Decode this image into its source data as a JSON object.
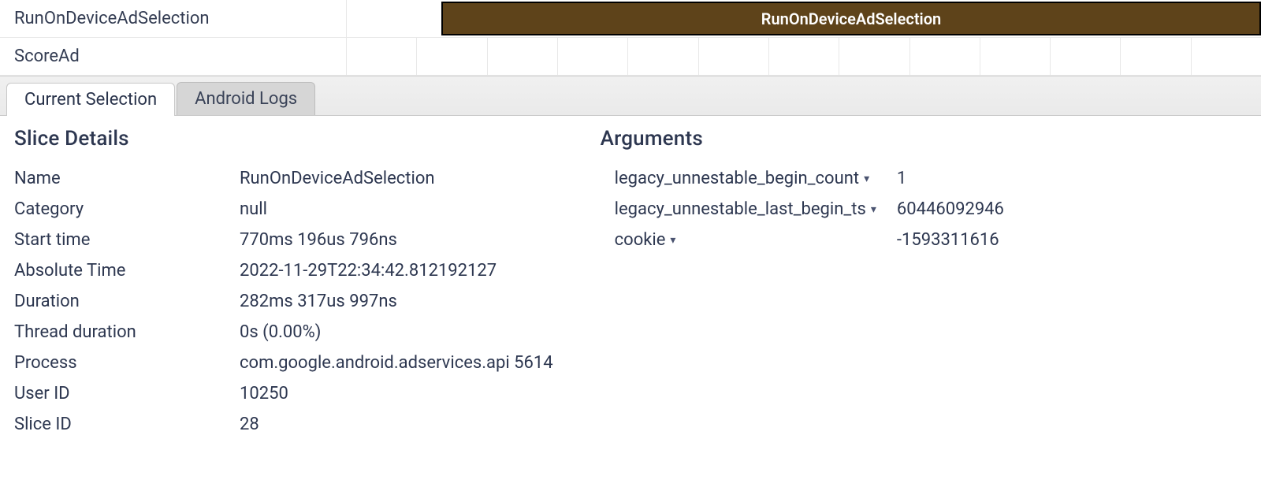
{
  "tracks": [
    {
      "label": "RunOnDeviceAdSelection",
      "slice_label": "RunOnDeviceAdSelection",
      "has_slice": true
    },
    {
      "label": "ScoreAd",
      "slice_label": "",
      "has_slice": false
    }
  ],
  "tabs": {
    "current_selection": "Current Selection",
    "android_logs": "Android Logs"
  },
  "slice_details": {
    "heading": "Slice Details",
    "rows": [
      {
        "key": "Name",
        "value": "RunOnDeviceAdSelection"
      },
      {
        "key": "Category",
        "value": "null"
      },
      {
        "key": "Start time",
        "value": "770ms 196us 796ns"
      },
      {
        "key": "Absolute Time",
        "value": "2022-11-29T22:34:42.812192127"
      },
      {
        "key": "Duration",
        "value": "282ms 317us 997ns"
      },
      {
        "key": "Thread duration",
        "value": "0s (0.00%)"
      },
      {
        "key": "Process",
        "value": "com.google.android.adservices.api 5614"
      },
      {
        "key": "User ID",
        "value": "10250"
      },
      {
        "key": "Slice ID",
        "value": "28"
      }
    ]
  },
  "arguments": {
    "heading": "Arguments",
    "rows": [
      {
        "key": "legacy_unnestable_begin_count",
        "value": "1"
      },
      {
        "key": "legacy_unnestable_last_begin_ts",
        "value": "60446092946"
      },
      {
        "key": "cookie",
        "value": "-1593311616"
      }
    ]
  }
}
